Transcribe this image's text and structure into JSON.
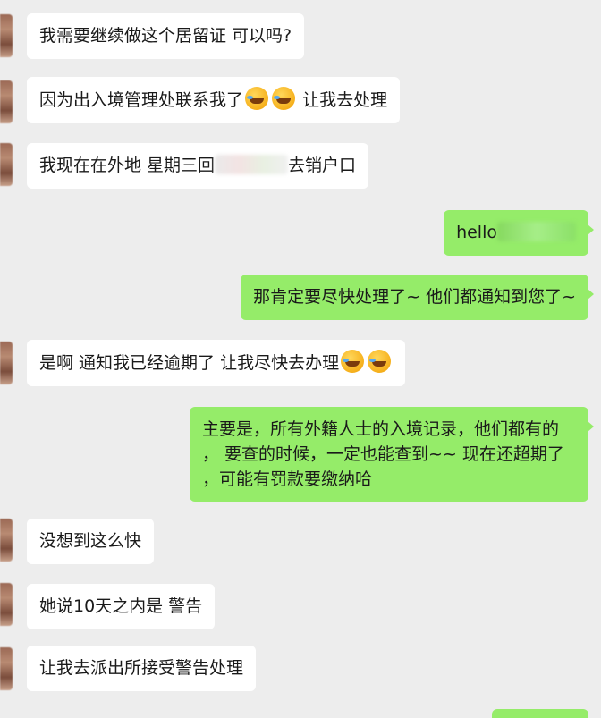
{
  "messages": [
    {
      "side": "left",
      "text": "我需要继续做这个居留证 可以吗?"
    },
    {
      "side": "left",
      "text": "因为出入境管理处联系我了",
      "emojis": [
        "laugh-cry-emoji",
        "laugh-cry-emoji"
      ],
      "text_after": "让我去处理"
    },
    {
      "side": "left",
      "text": "我现在在外地 星期三回",
      "text_after": "去销户口"
    },
    {
      "side": "right",
      "text": "hello"
    },
    {
      "side": "right",
      "text": "那肯定要尽快处理了~ 他们都通知到您了~"
    },
    {
      "side": "left",
      "text": "是啊 通知我已经逾期了 让我尽快去办理",
      "emojis": [
        "laugh-cry-emoji",
        "laugh-cry-emoji"
      ]
    },
    {
      "side": "right",
      "lines": [
        "主要是，所有外籍人士的入境记录，他们都有的",
        "， 要查的时候，一定也能查到~~ 现在还超期了",
        "，可能有罚款要缴纳哈"
      ]
    },
    {
      "side": "left",
      "text": "没想到这么快"
    },
    {
      "side": "left",
      "text": "她说10天之内是 警告"
    },
    {
      "side": "left",
      "text": "让我去派出所接受警告处理"
    }
  ],
  "colors": {
    "background": "#ededed",
    "left_bubble": "#ffffff",
    "right_bubble": "#95ec69"
  }
}
